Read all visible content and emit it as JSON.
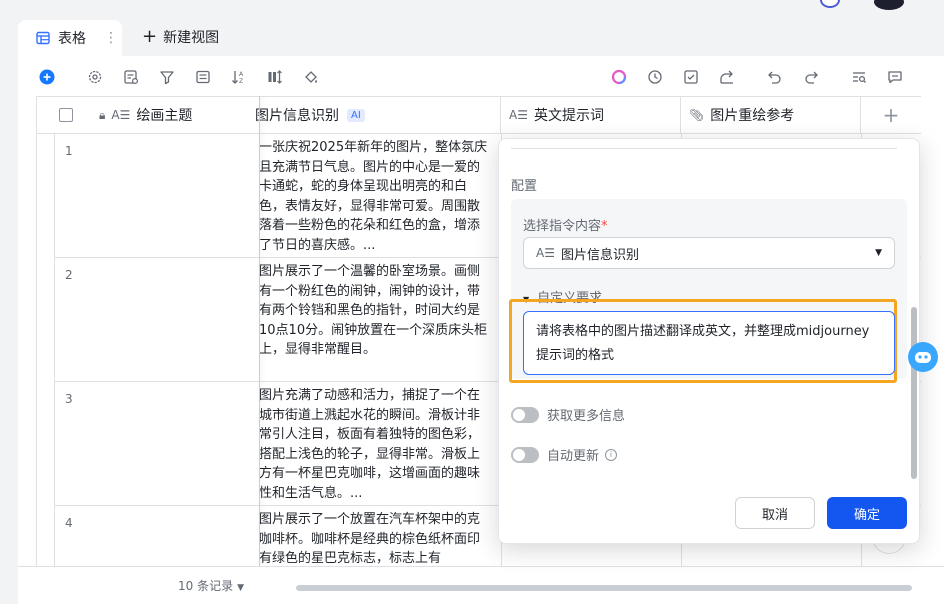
{
  "view_tabs": {
    "active_label": "表格",
    "more_icon": "more-vertical-icon",
    "new_view_label": "新建视图"
  },
  "toolbar": {
    "icons": [
      "add-record-icon",
      "settings-icon",
      "field-config-icon",
      "filter-icon",
      "group-icon",
      "sort-icon",
      "row-height-icon",
      "paint-bucket-icon",
      "ai-icon",
      "clock-icon",
      "checkbox-icon",
      "share-icon",
      "undo-icon",
      "redo-icon",
      "search-icon",
      "comment-icon"
    ]
  },
  "table": {
    "columns": [
      {
        "label": "绘画主题",
        "icon": "text-field-icon",
        "locked": true
      },
      {
        "label": "图片信息识别",
        "icon": "text-field-icon",
        "badge": "AI"
      },
      {
        "label": "英文提示词",
        "icon": "text-field-icon"
      },
      {
        "label": "图片重绘参考",
        "icon": "attachment-icon"
      }
    ],
    "rows": [
      {
        "index": "1",
        "image_info": "一张庆祝2025年新年的图片，整体氛庆且充满节日气息。图片的中心是一爱的卡通蛇，蛇的身体呈现出明亮的和白色，表情友好，显得非常可爱。周围散落着一些粉色的花朵和红色的盒，增添了节日的喜庆感。..."
      },
      {
        "index": "2",
        "image_info": "图片展示了一个温馨的卧室场景。画侧有一个粉红色的闹钟，闹钟的设计，带有两个铃铛和黑色的指针，时间大约是10点10分。闹钟放置在一个深质床头柜上，显得非常醒目。"
      },
      {
        "index": "3",
        "image_info": "图片充满了动感和活力，捕捉了一个在城市街道上溅起水花的瞬间。滑板计非常引人注目，板面有着独特的图色彩，搭配上浅色的轮子，显得非常。滑板上方有一杯星巴克咖啡，这增画面的趣味性和生活气息。..."
      },
      {
        "index": "4",
        "image_info": "图片展示了一个放置在汽车杯架中的克咖啡杯。咖啡杯是经典的棕色纸杯面印有绿色的星巴克标志，标志上有"
      }
    ],
    "record_count": "10 条记录"
  },
  "config_panel": {
    "section_title": "配置",
    "select_label": "选择指令内容",
    "required_mark": "*",
    "selected_value": "图片信息识别",
    "custom_requirement_label": "自定义要求",
    "custom_requirement_text": "请将表格中的图片描述翻译成英文，并整理成midjourney提示词的格式",
    "toggle_more_info": "获取更多信息",
    "toggle_auto_update": "自动更新",
    "cancel_label": "取消",
    "confirm_label": "确定"
  },
  "colors": {
    "primary": "#1456f0",
    "highlight": "#f4a521",
    "add_button": "#1677ff"
  }
}
